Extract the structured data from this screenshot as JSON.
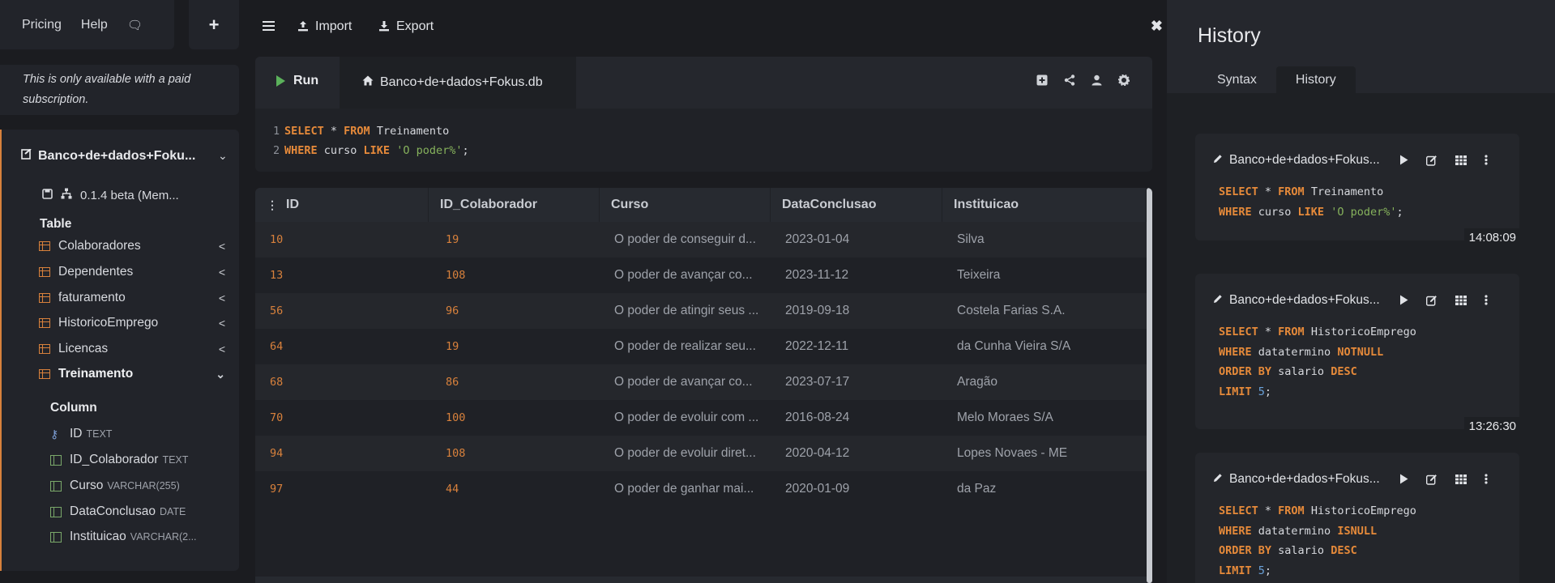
{
  "topnav": {
    "pricing": "Pricing",
    "help": "Help",
    "chat_icon": "chat-icon",
    "plus": "+"
  },
  "paid_note": "This is only available with a paid subscription.",
  "db": {
    "name": "Banco+de+dados+Foku...",
    "version": "0.1.4 beta (Mem...",
    "table_label": "Table",
    "tables": [
      {
        "name": "Colaboradores",
        "chevron": "<"
      },
      {
        "name": "Dependentes",
        "chevron": "<"
      },
      {
        "name": "faturamento",
        "chevron": "<"
      },
      {
        "name": "HistoricoEmprego",
        "chevron": "<"
      },
      {
        "name": "Licencas",
        "chevron": "<"
      },
      {
        "name": "Treinamento",
        "chevron": "⌄"
      }
    ],
    "column_label": "Column",
    "columns": [
      {
        "name": "ID",
        "type": "TEXT"
      },
      {
        "name": "ID_Colaborador",
        "type": "TEXT"
      },
      {
        "name": "Curso",
        "type": "VARCHAR(255)"
      },
      {
        "name": "DataConclusao",
        "type": "DATE"
      },
      {
        "name": "Instituicao",
        "type": "VARCHAR(2..."
      }
    ]
  },
  "toolbar": {
    "import": "Import",
    "export": "Export",
    "close": "✖"
  },
  "editor": {
    "run": "Run",
    "file_tab": "Banco+de+dados+Fokus.db",
    "lines": [
      {
        "n": "1",
        "kw1": "SELECT",
        "t1": " * ",
        "kw2": "FROM",
        "t2": " Treinamento",
        "str": "",
        "t3": ""
      },
      {
        "n": "2",
        "kw1": "WHERE",
        "t1": " curso ",
        "kw2": "LIKE",
        "t2": " ",
        "str": "'O poder%'",
        "t3": ";"
      }
    ]
  },
  "results": {
    "headers": [
      "ID",
      "ID_Colaborador",
      "Curso",
      "DataConclusao",
      "Instituicao"
    ],
    "rows": [
      [
        "10",
        "19",
        "O poder de conseguir d...",
        "2023-01-04",
        "Silva"
      ],
      [
        "13",
        "108",
        "O poder de avançar co...",
        "2023-11-12",
        "Teixeira"
      ],
      [
        "56",
        "96",
        "O poder de atingir seus ...",
        "2019-09-18",
        "Costela Farias S.A."
      ],
      [
        "64",
        "19",
        "O poder de realizar seu...",
        "2022-12-11",
        "da Cunha Vieira S/A"
      ],
      [
        "68",
        "86",
        "O poder de avançar co...",
        "2023-07-17",
        "Aragão"
      ],
      [
        "70",
        "100",
        "O poder de evoluir com ...",
        "2016-08-24",
        "Melo Moraes S/A"
      ],
      [
        "94",
        "108",
        "O poder de evoluir diret...",
        "2020-04-12",
        "Lopes Novaes - ME"
      ],
      [
        "97",
        "44",
        "O poder de ganhar mai...",
        "2020-01-09",
        "da Paz"
      ]
    ]
  },
  "history": {
    "title": "History",
    "tabs": [
      "Syntax",
      "History"
    ],
    "cards": [
      {
        "db": "Banco+de+dados+Fokus...",
        "time": "14:08:09",
        "lines": [
          [
            [
              "kw",
              "SELECT"
            ],
            [
              "t",
              " * "
            ],
            [
              "kw",
              "FROM"
            ],
            [
              "t",
              " Treinamento"
            ]
          ],
          [
            [
              "kw",
              "WHERE"
            ],
            [
              "t",
              " curso "
            ],
            [
              "kw",
              "LIKE"
            ],
            [
              "t",
              " "
            ],
            [
              "str",
              "'O poder%'"
            ],
            [
              "t",
              ";"
            ]
          ]
        ]
      },
      {
        "db": "Banco+de+dados+Fokus...",
        "time": "13:26:30",
        "lines": [
          [
            [
              "kw",
              "SELECT"
            ],
            [
              "t",
              " * "
            ],
            [
              "kw",
              "FROM"
            ],
            [
              "t",
              " HistoricoEmprego"
            ]
          ],
          [
            [
              "kw",
              "WHERE"
            ],
            [
              "t",
              " datatermino "
            ],
            [
              "kw",
              "NOTNULL"
            ]
          ],
          [
            [
              "kw",
              "ORDER BY"
            ],
            [
              "t",
              " salario "
            ],
            [
              "kw",
              "DESC"
            ]
          ],
          [
            [
              "kw",
              "LIMIT"
            ],
            [
              "t",
              " "
            ],
            [
              "num",
              "5"
            ],
            [
              "t",
              ";"
            ]
          ]
        ]
      },
      {
        "db": "Banco+de+dados+Fokus...",
        "time": "",
        "lines": [
          [
            [
              "kw",
              "SELECT"
            ],
            [
              "t",
              " * "
            ],
            [
              "kw",
              "FROM"
            ],
            [
              "t",
              " HistoricoEmprego"
            ]
          ],
          [
            [
              "kw",
              "WHERE"
            ],
            [
              "t",
              " datatermino "
            ],
            [
              "kw",
              "ISNULL"
            ]
          ],
          [
            [
              "kw",
              "ORDER BY"
            ],
            [
              "t",
              " salario "
            ],
            [
              "kw",
              "DESC"
            ]
          ],
          [
            [
              "kw",
              "LIMIT"
            ],
            [
              "t",
              " "
            ],
            [
              "num",
              "5"
            ],
            [
              "t",
              ";"
            ]
          ]
        ]
      }
    ]
  },
  "colors": {
    "accent": "#d8813c",
    "run_green": "#5bb15b",
    "string": "#86b25c",
    "number": "#6aa1d9"
  }
}
